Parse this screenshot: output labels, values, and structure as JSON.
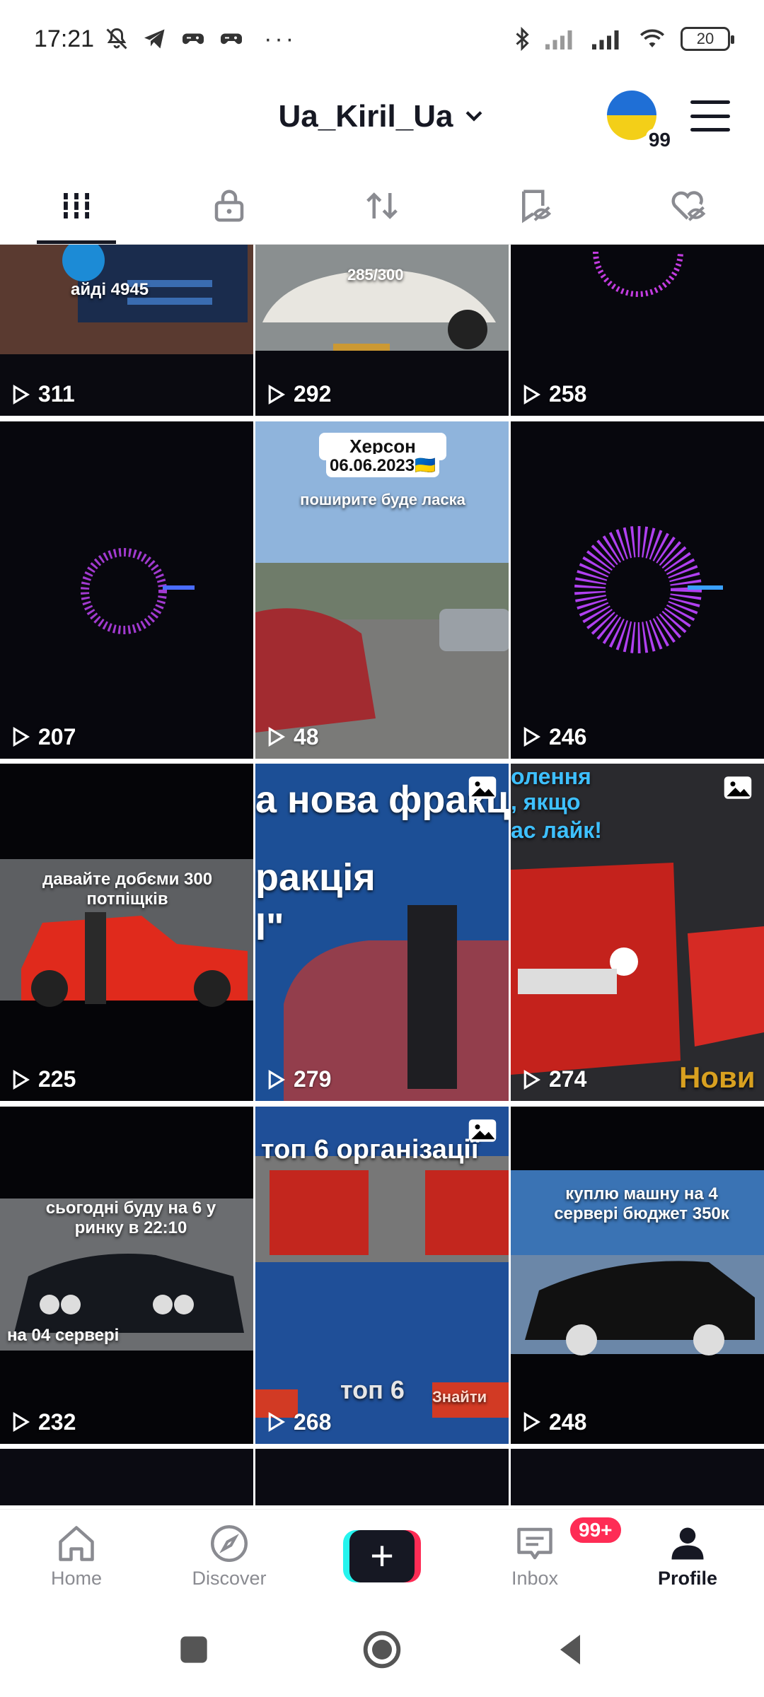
{
  "status_bar": {
    "time": "17:21",
    "battery": "20",
    "icons": [
      "mute-icon",
      "telegram-icon",
      "gamepad-icon",
      "gamepad-icon",
      "more-icon",
      "bluetooth-icon",
      "signal-icon",
      "signal-icon",
      "wifi-icon",
      "battery-icon"
    ],
    "more": "···"
  },
  "header": {
    "username": "Ua_Kiril_Ua",
    "avatar_badge": "99"
  },
  "tabs": [
    {
      "name": "videos",
      "icon": "grid-icon",
      "active": true
    },
    {
      "name": "private",
      "icon": "lock-icon"
    },
    {
      "name": "reposts",
      "icon": "repost-icon"
    },
    {
      "name": "saved",
      "icon": "bookmark-icon"
    },
    {
      "name": "liked",
      "icon": "heart-hidden-icon"
    }
  ],
  "videos": [
    {
      "views": "311",
      "caption": "айді 4945"
    },
    {
      "views": "292",
      "caption": "285/300"
    },
    {
      "views": "258"
    },
    {
      "views": "207"
    },
    {
      "views": "48",
      "caption": "Херсон",
      "caption2": "06.06.2023🇺🇦",
      "caption3": "поширите буде ласка"
    },
    {
      "views": "246"
    },
    {
      "views": "225",
      "caption": "давайте добєми 300 потпіщків"
    },
    {
      "views": "279",
      "caption": "а нова фракц",
      "caption2": "ракція",
      "caption3": "I\""
    },
    {
      "views": "274",
      "caption": "олення",
      "caption2": ", якщо",
      "caption3": "ас лайк!",
      "caption4": "Нови"
    },
    {
      "views": "232",
      "caption": "сьогодні буду на 6 у ринку в 22:10",
      "caption2": "на 04 сервері"
    },
    {
      "views": "268",
      "caption": "топ 6 організації",
      "caption2": "топ 6",
      "caption3": "Знайти"
    },
    {
      "views": "248",
      "caption": "куплю машну на 4 сервері бюджет 350к"
    }
  ],
  "bottom_nav": {
    "home": "Home",
    "discover": "Discover",
    "inbox": "Inbox",
    "inbox_badge": "99+",
    "profile": "Profile",
    "create_symbol": "+"
  },
  "colors": {
    "accent_red": "#fe2c55",
    "accent_cyan": "#25f4ee",
    "text_primary": "#161823",
    "text_muted": "#8a8b91"
  }
}
